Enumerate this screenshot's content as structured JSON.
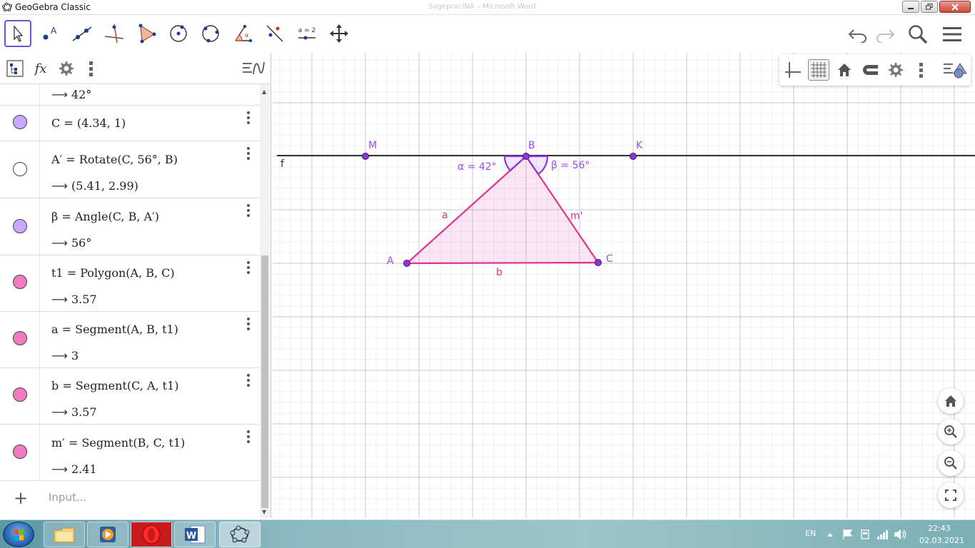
{
  "window": {
    "title": "GeoGebra Classic",
    "background_title": "Sageprai.INA – Microsoft Word"
  },
  "toolbar": {
    "tools": [
      "move-tool",
      "point-tool",
      "line-tool",
      "perpendicular-line-tool",
      "polygon-tool",
      "circle-tool",
      "circle-three-points-tool",
      "angle-tool",
      "reflect-tool",
      "slider-tool",
      "move-graphics-view-tool"
    ],
    "slider_tool_label": "a = 2",
    "right": [
      "undo-icon",
      "redo-icon",
      "search-icon",
      "menu-icon"
    ]
  },
  "algebra": {
    "input_placeholder": "Input...",
    "entries": [
      {
        "marble": "none",
        "definition": "",
        "value": "42°"
      },
      {
        "marble": "#b388ff",
        "definition": "C  =  (4.34,  1)",
        "value": ""
      },
      {
        "marble": "hollow",
        "definition": "A′  =  Rotate(C, 56°, B)",
        "value": "(5.41,  2.99)"
      },
      {
        "marble": "#b388ff",
        "definition": "β  =  Angle(C, B, A′)",
        "value": "56°"
      },
      {
        "marble": "#ef70b9",
        "definition": "t1  =  Polygon(A, B, C)",
        "value": "3.57"
      },
      {
        "marble": "#ef70b9",
        "definition": "a  =  Segment(A, B, t1)",
        "value": "3"
      },
      {
        "marble": "#ef70b9",
        "definition": "b  =  Segment(C, A, t1)",
        "value": "3.57"
      },
      {
        "marble": "#ef70b9",
        "definition": "m′  =  Segment(B, C, t1)",
        "value": "2.41"
      }
    ],
    "arrow": "⟶"
  },
  "graphics": {
    "line_label": "f",
    "points": {
      "M": "M",
      "B": "B",
      "K": "K",
      "A": "A",
      "C": "C"
    },
    "angle_alpha": "α = 42°",
    "angle_beta": "β = 56°",
    "segment_labels": {
      "a": "a",
      "b": "b",
      "m": "m'"
    },
    "colors": {
      "polygon": "#e0338f",
      "points": "#8d33e0",
      "line": "#333333",
      "labels": "#9b4de8",
      "segment_labels": "#d6318c"
    }
  },
  "taskbar": {
    "language": "EN",
    "time": "22:43",
    "date": "02.03.2021",
    "apps": [
      "windows-explorer",
      "media-player",
      "opera",
      "microsoft-word",
      "geogebra"
    ]
  }
}
